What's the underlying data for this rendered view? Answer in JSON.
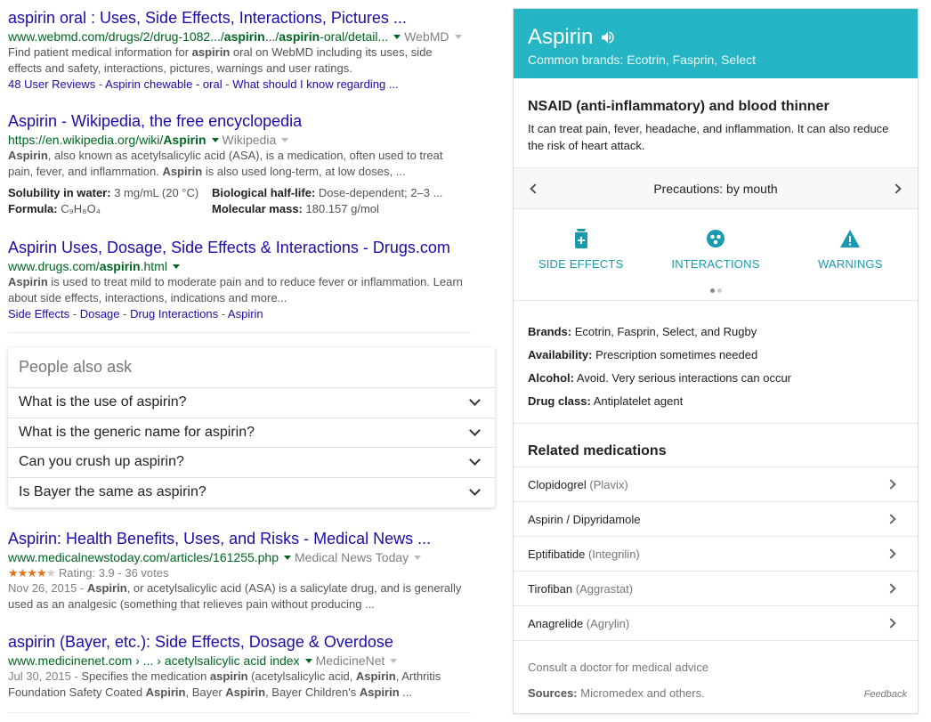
{
  "results": [
    {
      "title": "aspirin oral : Uses, Side Effects, Interactions, Pictures ...",
      "url_pre": "www.webmd.com/drugs/2/drug-1082.../",
      "url_b1": "aspirin",
      "url_mid": ".../",
      "url_b2": "aspirin",
      "url_post": "-oral/detail...",
      "site": "WebMD",
      "snip1_pre": "Find patient medical information for ",
      "snip1_b": "aspirin",
      "snip1_post": " oral on WebMD including its uses, side",
      "snip2": "effects and safety, interactions, pictures, warnings and user ratings.",
      "links": [
        "48 User Reviews",
        "Aspirin chewable - oral",
        "What should I know regarding ..."
      ]
    },
    {
      "title": "Aspirin - Wikipedia, the free encyclopedia",
      "url_pre": "https://en.wikipedia.org/wiki/",
      "url_b": "Aspirin",
      "site": "Wikipedia",
      "snip1_b": "Aspirin",
      "snip1_post": ", also known as acetylsalicylic acid (ASA), is a medication, often used to treat",
      "snip2_pre": "pain, fever, and inflammation. ",
      "snip2_b": "Aspirin",
      "snip2_post": " is also used long-term, at low doses, ...",
      "facts": [
        {
          "k": "Solubility in water:",
          "v": "3 mg/mL (20 °C)"
        },
        {
          "k": "Biological half-life:",
          "v": "Dose-dependent; 2–3 ..."
        },
        {
          "k": "Formula:",
          "v": "C₉H₈O₄"
        },
        {
          "k": "Molecular mass:",
          "v": "180.157 g/mol"
        }
      ]
    },
    {
      "title": "Aspirin Uses, Dosage, Side Effects & Interactions - Drugs.com",
      "url_pre": "www.drugs.com/",
      "url_b": "aspirin",
      "url_post": ".html",
      "snip1_b": "Aspirin",
      "snip1_post": " is used to treat mild to moderate pain and to reduce fever or inflammation. Learn",
      "snip2": "about side effects, interactions, indications and more...",
      "links": [
        "Side Effects",
        "Dosage",
        "Drug Interactions",
        "Aspirin"
      ]
    }
  ],
  "paa": {
    "title": "People also ask",
    "questions": [
      "What is the use of aspirin?",
      "What is the generic name for aspirin?",
      "Can you crush up aspirin?",
      "Is Bayer the same as aspirin?"
    ]
  },
  "results2": [
    {
      "title": "Aspirin: Health Benefits, Uses, and Risks - Medical News ...",
      "url": "www.medicalnewstoday.com/articles/161255.php",
      "site": "Medical News Today",
      "stars": "★★★★",
      "star_empty": "★",
      "rating": "Rating: 3.9 - 36 votes",
      "date": "Nov 26, 2015 - ",
      "snip1_b": "Aspirin",
      "snip1_post": ", or acetylsalicylic acid (ASA) is a salicylate drug, and is generally",
      "snip2": "used as an analgesic (something that relieves pain without producing ..."
    },
    {
      "title": "aspirin (Bayer, etc.): Side Effects, Dosage & Overdose",
      "url": "www.medicinenet.com › ... › acetylsalicylic acid index",
      "site": "MedicineNet",
      "date": "Jul 30, 2015 - ",
      "snip1_pre": "Specifies the medication ",
      "snip1_b": "aspirin",
      "snip1_mid": " (acetylsalicylic acid, ",
      "snip1_b2": "Aspirin",
      "snip1_post": ", Arthritis",
      "snip2_pre": "Foundation Safety Coated ",
      "snip2_b": "Aspirin",
      "snip2_mid": ", Bayer ",
      "snip2_b2": "Aspirin",
      "snip2_mid2": ", Bayer Children's ",
      "snip2_b3": "Aspirin",
      "snip2_post": " ..."
    }
  ],
  "kp": {
    "title": "Aspirin",
    "subtitle": "Common brands: Ecotrin, Fasprin, Select",
    "heading": "NSAID (anti-inflammatory) and blood thinner",
    "desc": "It can treat pain, fever, headache, and inflammation. It can also reduce the risk of heart attack.",
    "precautions": "Precautions: by mouth",
    "categories": [
      "SIDE EFFECTS",
      "INTERACTIONS",
      "WARNINGS"
    ],
    "props": [
      {
        "k": "Brands:",
        "v": "Ecotrin, Fasprin, Select, and Rugby"
      },
      {
        "k": "Availability:",
        "v": "Prescription sometimes needed"
      },
      {
        "k": "Alcohol:",
        "v": "Avoid. Very serious interactions can occur"
      },
      {
        "k": "Drug class:",
        "v": "Antiplatelet agent"
      }
    ],
    "related_title": "Related medications",
    "related": [
      {
        "name": "Clopidogrel",
        "brand": "(Plavix)"
      },
      {
        "name": "Aspirin / Dipyridamole",
        "brand": ""
      },
      {
        "name": "Eptifibatide",
        "brand": "(Integrilin)"
      },
      {
        "name": "Tirofiban",
        "brand": "(Aggrastat)"
      },
      {
        "name": "Anagrelide",
        "brand": "(Agrylin)"
      }
    ],
    "consult": "Consult a doctor for medical advice",
    "sources_k": "Sources:",
    "sources_v": "Micromedex and others.",
    "feedback": "Feedback"
  },
  "colors": {
    "link": "#1a0dab",
    "url": "#006621",
    "panel_header": "#25b5c4",
    "panel_accent": "#1a9ab0",
    "star": "#e7711b"
  }
}
